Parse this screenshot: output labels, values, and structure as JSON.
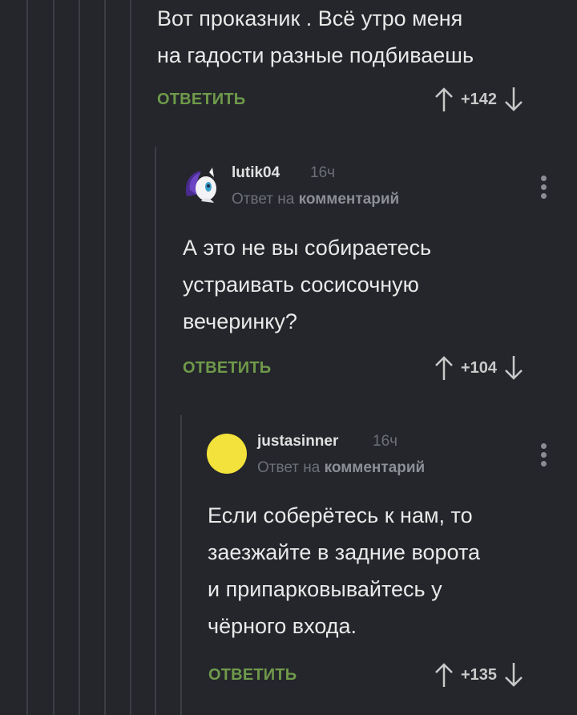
{
  "comments": [
    {
      "text_lines": [
        "Вот проказник . Всё утро меня",
        "на гадости разные подбиваешь"
      ],
      "reply_label": "ОТВЕТИТЬ",
      "score": "+142"
    },
    {
      "author": "lutik04",
      "time": "16ч",
      "reply_to_prefix": "Ответ на",
      "reply_to_link": "комментарий",
      "text_lines": [
        "А это не вы собираетесь",
        "устраивать сосисочную",
        "вечеринку?"
      ],
      "reply_label": "ОТВЕТИТЬ",
      "score": "+104"
    },
    {
      "author": "justasinner",
      "time": "16ч",
      "reply_to_prefix": "Ответ на",
      "reply_to_link": "комментарий",
      "text_lines": [
        "Если соберётесь к нам, то",
        "заезжайте в задние ворота",
        "и припарковывайтесь у",
        "чёрного входа."
      ],
      "reply_label": "ОТВЕТИТЬ",
      "score": "+135"
    }
  ],
  "icons": {
    "upvote": "arrow-up-icon",
    "downvote": "arrow-down-icon",
    "more": "more-vertical-icon"
  },
  "colors": {
    "background": "#24262b",
    "reply_green": "#6f9a4a",
    "avatar_yellow": "#f4e23c"
  }
}
